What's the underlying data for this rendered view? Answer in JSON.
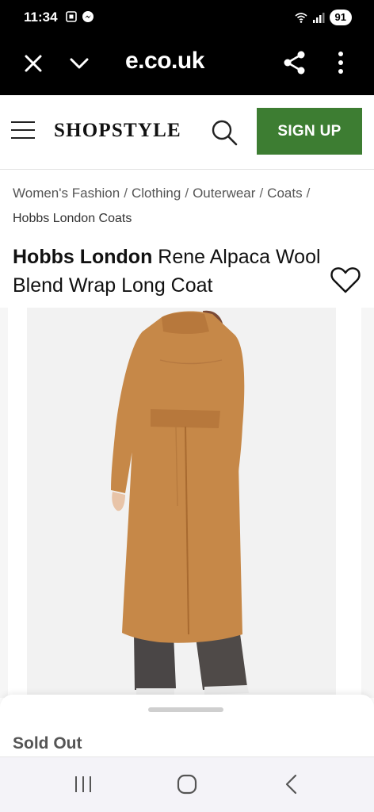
{
  "status_bar": {
    "time": "11:34",
    "battery": "91",
    "left_icons": [
      "screenshot-icon",
      "messenger-icon"
    ],
    "right_icons": [
      "wifi-icon",
      "signal-icon"
    ]
  },
  "browser": {
    "url": "e.co.uk",
    "icons": [
      "close-icon",
      "chevron-down-icon",
      "share-icon",
      "more-vert-icon"
    ]
  },
  "site": {
    "logo": "SHOPSTYLE",
    "signup_label": "SIGN UP",
    "accent_color": "#3d7d32"
  },
  "breadcrumb": {
    "items": [
      "Women's Fashion",
      "Clothing",
      "Outerwear",
      "Coats"
    ],
    "separator": "/",
    "current": "Hobbs London Coats"
  },
  "product": {
    "brand": "Hobbs London",
    "name": "Rene Alpaca Wool Blend Wrap Long Coat",
    "coat_color": "#c68848",
    "status": "Sold Out"
  },
  "nav": {
    "icons": [
      "recents-icon",
      "home-icon",
      "back-icon"
    ]
  }
}
